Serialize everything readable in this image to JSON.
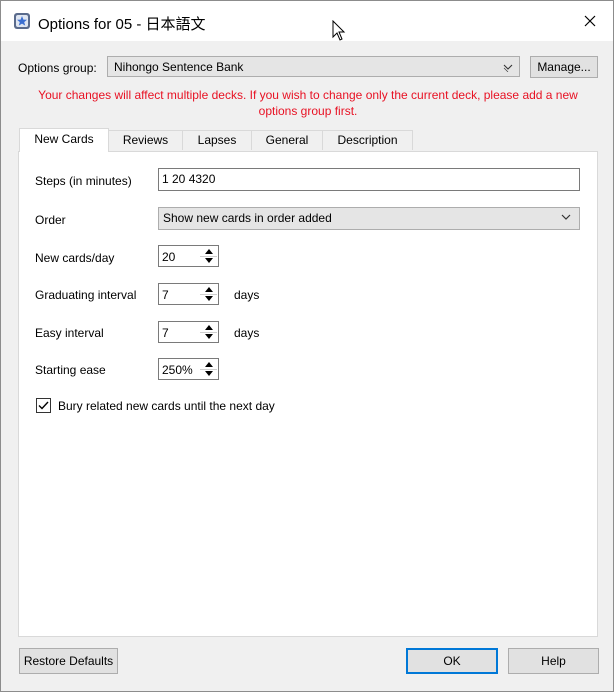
{
  "window": {
    "title": "Options for 05 - 日本語文"
  },
  "options_group": {
    "label": "Options group:",
    "selected": "Nihongo Sentence Bank",
    "manage_label": "Manage..."
  },
  "warning": "Your changes will affect multiple decks. If you wish to change only the current deck, please add a new options group first.",
  "tabs": [
    {
      "label": "New Cards",
      "active": true
    },
    {
      "label": "Reviews"
    },
    {
      "label": "Lapses"
    },
    {
      "label": "General"
    },
    {
      "label": "Description"
    }
  ],
  "new_cards": {
    "steps_label": "Steps (in minutes)",
    "steps_value": "1 20 4320",
    "order_label": "Order",
    "order_selected": "Show new cards in order added",
    "per_day_label": "New cards/day",
    "per_day_value": "20",
    "grad_label": "Graduating interval",
    "grad_value": "7",
    "grad_unit": "days",
    "easy_label": "Easy interval",
    "easy_value": "7",
    "easy_unit": "days",
    "ease_label": "Starting ease",
    "ease_value": "250%",
    "bury_label": "Bury related new cards until the next day",
    "bury_checked": true
  },
  "footer": {
    "restore_label": "Restore Defaults",
    "ok_label": "OK",
    "help_label": "Help"
  },
  "colors": {
    "warning": "#e81123",
    "accent": "#0078d7"
  }
}
